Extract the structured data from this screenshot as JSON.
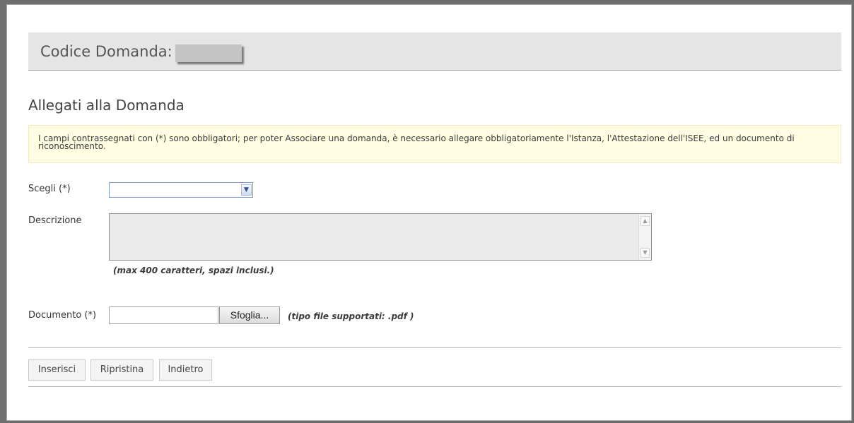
{
  "header": {
    "title": "Codice Domanda:"
  },
  "section": {
    "title": "Allegati alla Domanda"
  },
  "notice": {
    "text": "I campi contrassegnati con (*) sono obbligatori; per poter Associare una domanda, è necessario allegare obbligatoriamente l'Istanza, l'Attestazione dell'ISEE, ed un documento di riconoscimento."
  },
  "form": {
    "scegli_label": "Scegli (*)",
    "scegli_value": "",
    "descrizione_label": "Descrizione",
    "descrizione_value": "",
    "descrizione_hint": "(max 400 caratteri, spazi inclusi.)",
    "documento_label": "Documento (*)",
    "documento_value": "",
    "browse_label": "Sfoglia...",
    "file_hint": "(tipo file supportati: .pdf )"
  },
  "buttons": {
    "inserisci": "Inserisci",
    "ripristina": "Ripristina",
    "indietro": "Indietro"
  },
  "icons": {
    "select_arrow": "chevron-down-icon",
    "scroll_up": "arrow-up-icon",
    "scroll_down": "arrow-down-icon"
  },
  "colors": {
    "header_bg": "#e5e5e5",
    "notice_bg": "#fffde2",
    "select_border": "#7a9cd3"
  }
}
